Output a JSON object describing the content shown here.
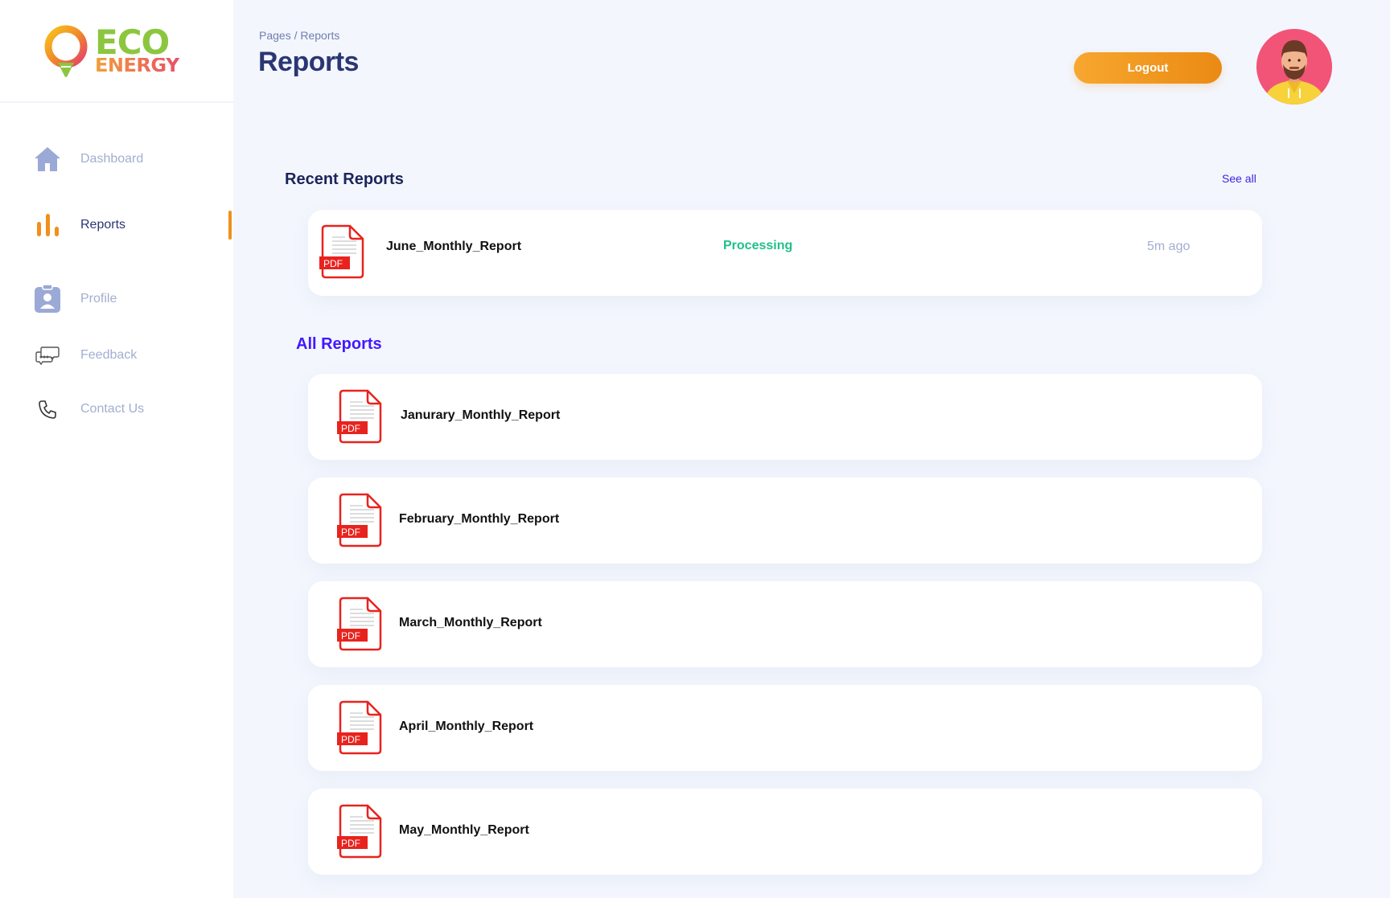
{
  "brand": {
    "name_top": "ECO",
    "name_bottom": "ENERGY"
  },
  "sidebar": {
    "items": [
      {
        "label": "Dashboard",
        "icon": "home-icon",
        "active": false
      },
      {
        "label": "Reports",
        "icon": "bar-chart-icon",
        "active": true
      },
      {
        "label": "Profile",
        "icon": "id-badge-icon",
        "active": false
      },
      {
        "label": "Feedback",
        "icon": "chat-bubbles-icon",
        "active": false
      },
      {
        "label": "Contact Us",
        "icon": "phone-icon",
        "active": false
      }
    ]
  },
  "header": {
    "breadcrumb": "Pages / Reports",
    "title": "Reports",
    "logout_label": "Logout"
  },
  "recent": {
    "title": "Recent Reports",
    "see_all": "See all",
    "items": [
      {
        "name": "June_Monthly_Report",
        "status": "Processing",
        "time": "5m ago",
        "badge": "PDF"
      }
    ]
  },
  "all_reports": {
    "title": "All Reports",
    "items": [
      {
        "name": "Janurary_Monthly_Report",
        "badge": "PDF"
      },
      {
        "name": "February_Monthly_Report",
        "badge": "PDF"
      },
      {
        "name": "March_Monthly_Report",
        "badge": "PDF"
      },
      {
        "name": "April_Monthly_Report",
        "badge": "PDF"
      },
      {
        "name": "May_Monthly_Report",
        "badge": "PDF"
      }
    ]
  },
  "colors": {
    "accent": "#f0901a",
    "primary_text": "#2b3674",
    "muted_text": "#a3aed0",
    "status_processing": "#1fc08a",
    "pdf_red": "#e8231e",
    "link": "#4318ff"
  }
}
